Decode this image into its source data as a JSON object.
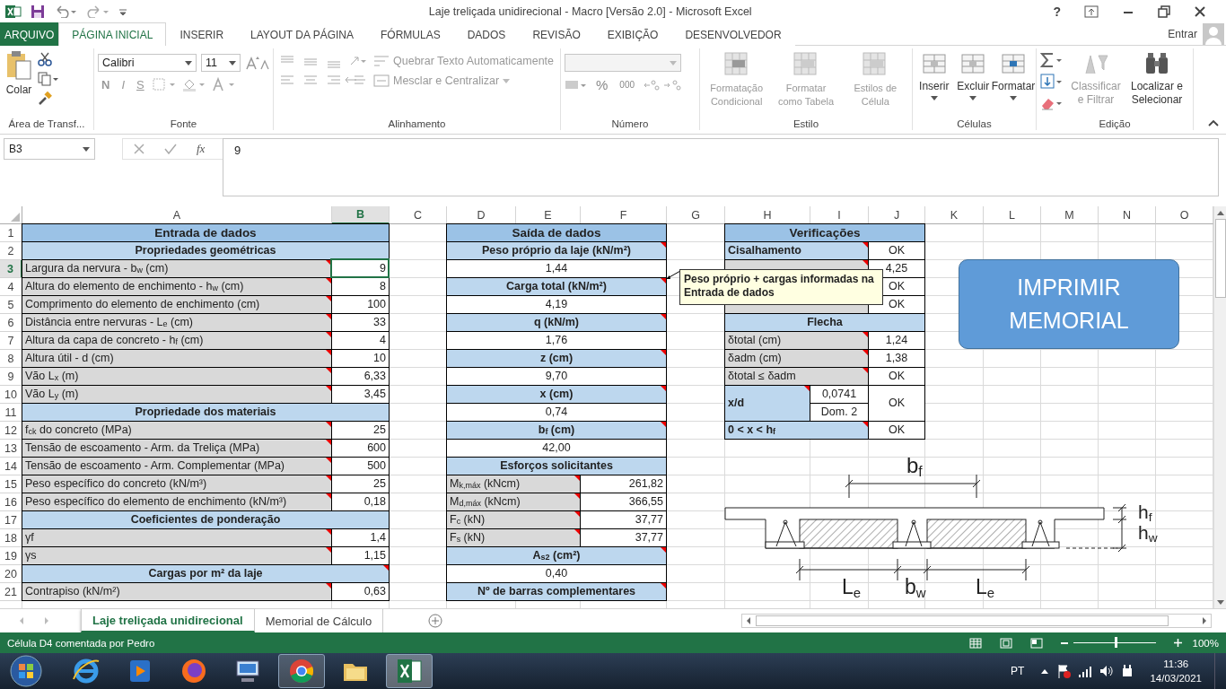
{
  "window": {
    "title": "Laje treliçada unidirecional - Macro [Versão 2.0] - Microsoft Excel",
    "help": "?",
    "account": "Entrar"
  },
  "tabs": [
    {
      "label": "ARQUIVO",
      "kind": "file",
      "selected": false
    },
    {
      "label": "PÁGINA INICIAL",
      "kind": "tab",
      "selected": true
    },
    {
      "label": "INSERIR",
      "kind": "tab",
      "selected": false
    },
    {
      "label": "LAYOUT DA PÁGINA",
      "kind": "tab",
      "selected": false
    },
    {
      "label": "FÓRMULAS",
      "kind": "tab",
      "selected": false
    },
    {
      "label": "DADOS",
      "kind": "tab",
      "selected": false
    },
    {
      "label": "REVISÃO",
      "kind": "tab",
      "selected": false
    },
    {
      "label": "EXIBIÇÃO",
      "kind": "tab",
      "selected": false
    },
    {
      "label": "DESENVOLVEDOR",
      "kind": "tab",
      "selected": false
    }
  ],
  "ribbon": {
    "clipboard": {
      "paste": "Colar",
      "label": "Área de Transf..."
    },
    "font": {
      "name": "Calibri",
      "size": "11",
      "bold": "N",
      "italic": "I",
      "underline": "S",
      "label": "Fonte"
    },
    "alignment": {
      "wrap": "Quebrar Texto Automaticamente",
      "merge": "Mesclar e Centralizar",
      "label": "Alinhamento"
    },
    "number": {
      "percent": "%",
      "thousands": "000",
      "label": "Número"
    },
    "styles": {
      "buttons": [
        {
          "label": "Formatação Condicional",
          "disabled": true
        },
        {
          "label": "Formatar como Tabela",
          "disabled": true
        },
        {
          "label": "Estilos de Célula",
          "disabled": true
        }
      ],
      "label": "Estilo"
    },
    "cells": {
      "buttons": [
        {
          "label": "Inserir",
          "disabled": false
        },
        {
          "label": "Excluir",
          "disabled": false
        },
        {
          "label": "Formatar",
          "disabled": false
        }
      ],
      "label": "Células"
    },
    "editing": {
      "buttons": [
        {
          "label": "Classificar e Filtrar",
          "disabled": true
        },
        {
          "label": "Localizar e Selecionar",
          "disabled": false
        }
      ],
      "label": "Edição"
    }
  },
  "formula_bar": {
    "name_box": "B3",
    "fx": "fx",
    "value": "9"
  },
  "grid": {
    "columns": [
      {
        "label": "A",
        "selected": false
      },
      {
        "label": "B",
        "selected": true
      },
      {
        "label": "C",
        "selected": false
      },
      {
        "label": "D",
        "selected": false
      },
      {
        "label": "E",
        "selected": false
      },
      {
        "label": "F",
        "selected": false
      },
      {
        "label": "G",
        "selected": false
      },
      {
        "label": "H",
        "selected": false
      },
      {
        "label": "I",
        "selected": false
      },
      {
        "label": "J",
        "selected": false
      },
      {
        "label": "K",
        "selected": false
      },
      {
        "label": "L",
        "selected": false
      },
      {
        "label": "M",
        "selected": false
      },
      {
        "label": "N",
        "selected": false
      },
      {
        "label": "O",
        "selected": false
      }
    ],
    "rows": [
      {
        "label": "1",
        "selected": false
      },
      {
        "label": "2",
        "selected": false
      },
      {
        "label": "3",
        "selected": true
      },
      {
        "label": "4",
        "selected": false
      },
      {
        "label": "5",
        "selected": false
      },
      {
        "label": "6",
        "selected": false
      },
      {
        "label": "7",
        "selected": false
      },
      {
        "label": "8",
        "selected": false
      },
      {
        "label": "9",
        "selected": false
      },
      {
        "label": "10",
        "selected": false
      },
      {
        "label": "11",
        "selected": false
      },
      {
        "label": "12",
        "selected": false
      },
      {
        "label": "13",
        "selected": false
      },
      {
        "label": "14",
        "selected": false
      },
      {
        "label": "15",
        "selected": false
      },
      {
        "label": "16",
        "selected": false
      },
      {
        "label": "17",
        "selected": false
      },
      {
        "label": "18",
        "selected": false
      },
      {
        "label": "19",
        "selected": false
      },
      {
        "label": "20",
        "selected": false
      },
      {
        "label": "21",
        "selected": false
      }
    ]
  },
  "input": {
    "items": [
      {
        "kind": "header",
        "text": "Entrada de dados"
      },
      {
        "kind": "subheader",
        "text": "Propriedades geométricas",
        "comment": false
      },
      {
        "kind": "field",
        "label": "Largura da nervura - b$_{w}$ (cm)",
        "value": "9",
        "comment": true
      },
      {
        "kind": "field",
        "label": "Altura do elemento de enchimento - h$_{w}$ (cm)",
        "value": "8",
        "comment": true
      },
      {
        "kind": "field",
        "label": "Comprimento do elemento de enchimento (cm)",
        "value": "100",
        "comment": true
      },
      {
        "kind": "field",
        "label": "Distância entre nervuras - L$_{e}$ (cm)",
        "value": "33",
        "comment": true
      },
      {
        "kind": "field",
        "label": "Altura da capa de concreto - h$_{f}$ (cm)",
        "value": "4",
        "comment": true
      },
      {
        "kind": "field",
        "label": "Altura útil - d (cm)",
        "value": "10",
        "comment": true
      },
      {
        "kind": "field",
        "label": "Vão L$_{x}$ (m)",
        "value": "6,33",
        "comment": true
      },
      {
        "kind": "field",
        "label": "Vão L$_{y}$ (m)",
        "value": "3,45",
        "comment": true
      },
      {
        "kind": "subheader",
        "text": "Propriedade dos materiais",
        "comment": false
      },
      {
        "kind": "field",
        "label": "f$_{ck}$ do concreto (MPa)",
        "value": "25",
        "comment": true
      },
      {
        "kind": "field",
        "label": "Tensão de escoamento - Arm. da Treliça (MPa)",
        "value": "600",
        "comment": true
      },
      {
        "kind": "field",
        "label": "Tensão de escoamento - Arm. Complementar (MPa)",
        "value": "500",
        "comment": true
      },
      {
        "kind": "field",
        "label": "Peso específico do concreto (kN/m³)",
        "value": "25",
        "comment": true
      },
      {
        "kind": "field",
        "label": "Peso específico do elemento de enchimento (kN/m³)",
        "value": "0,18",
        "comment": true
      },
      {
        "kind": "subheader",
        "text": "Coeficientes de ponderação",
        "comment": false
      },
      {
        "kind": "field",
        "label": "γf",
        "value": "1,4",
        "comment": true
      },
      {
        "kind": "field",
        "label": "γs",
        "value": "1,15",
        "comment": true
      },
      {
        "kind": "subheader",
        "text": "Cargas por m² da laje",
        "comment": true
      },
      {
        "kind": "field",
        "label": "Contrapiso (kN/m²)",
        "value": "0,63",
        "comment": true
      }
    ]
  },
  "output": {
    "items": [
      {
        "kind": "header",
        "text": "Saída de dados"
      },
      {
        "kind": "subheader",
        "text": "Peso próprio da laje (kN/m²)",
        "comment": true
      },
      {
        "kind": "value",
        "text": "1,44"
      },
      {
        "kind": "subheader",
        "text": "Carga total (kN/m²)",
        "comment": true
      },
      {
        "kind": "value",
        "text": "4,19"
      },
      {
        "kind": "subheader",
        "text": "q (kN/m)",
        "comment": true
      },
      {
        "kind": "value",
        "text": "1,76"
      },
      {
        "kind": "subheader",
        "text": "z (cm)",
        "comment": true
      },
      {
        "kind": "value",
        "text": "9,70"
      },
      {
        "kind": "subheader",
        "text": "x (cm)",
        "comment": true
      },
      {
        "kind": "value",
        "text": "0,74"
      },
      {
        "kind": "subheader",
        "text": "b$_{f}$ (cm)",
        "comment": true
      },
      {
        "kind": "value",
        "text": "42,00"
      },
      {
        "kind": "subheader",
        "text": "Esforços solicitantes",
        "comment": false
      },
      {
        "kind": "field",
        "label": "M$_{k,máx}$ (kNcm)",
        "value": "261,82",
        "comment": true
      },
      {
        "kind": "field",
        "label": "M$_{d,máx}$ (kNcm)",
        "value": "366,55",
        "comment": true
      },
      {
        "kind": "field",
        "label": "F$_{c}$ (kN)",
        "value": "37,77",
        "comment": true
      },
      {
        "kind": "field",
        "label": "F$_{s}$ (kN)",
        "value": "37,77",
        "comment": true
      },
      {
        "kind": "subheader",
        "text": "A$_{s2}$ (cm²)",
        "comment": true
      },
      {
        "kind": "value",
        "text": "0,40"
      },
      {
        "kind": "subheader",
        "text": "Nº de barras complementares",
        "comment": true
      }
    ]
  },
  "checks": {
    "items": [
      {
        "kind": "header",
        "text": "Verificações"
      },
      {
        "kind": "check",
        "label": "Cisalhamento",
        "value": "OK",
        "comment": true
      },
      {
        "kind": "field",
        "value": "4,25",
        "comment": true
      },
      {
        "kind": "result",
        "value": "OK"
      },
      {
        "kind": "field",
        "value": "OK"
      },
      {
        "kind": "subheader",
        "text": "Flecha",
        "comment": false
      },
      {
        "kind": "field",
        "label": "δtotal (cm)",
        "value": "1,24",
        "comment": true
      },
      {
        "kind": "field",
        "label": "δadm (cm)",
        "value": "1,38",
        "comment": true
      },
      {
        "kind": "field",
        "label": "δtotal ≤ δadm",
        "value": "OK",
        "comment": true
      },
      {
        "kind": "ratio",
        "label": "x/d",
        "values": [
          "0,0741",
          "Dom. 2"
        ],
        "value": "OK",
        "comment": true
      },
      {
        "kind": "check",
        "label": "0 < x < h$_{f}$",
        "value": "OK",
        "comment": true
      }
    ]
  },
  "comment": {
    "text": "Peso próprio + cargas informadas na Entrada de dados"
  },
  "print_button": "IMPRIMIR MEMORIAL",
  "diagram": {
    "labels": [
      "b$_{f}$",
      "h$_{f}$",
      "h$_{w}$",
      "L$_{e}$",
      "b$_{w}$",
      "L$_{e}$"
    ]
  },
  "sheets": [
    {
      "label": "Laje treliçada unidirecional",
      "selected": true
    },
    {
      "label": "Memorial de Cálculo",
      "selected": false
    }
  ],
  "status_bar": {
    "text": "Célula D4 comentada por Pedro",
    "zoom": {
      "label": "100%",
      "level": 0.5
    }
  },
  "taskbar": {
    "apps": [
      {
        "kind": "ie",
        "open": false
      },
      {
        "kind": "media",
        "open": false
      },
      {
        "kind": "firefox",
        "open": false
      },
      {
        "kind": "computer",
        "open": false
      },
      {
        "kind": "chrome",
        "open": true
      },
      {
        "kind": "folder",
        "open": false
      },
      {
        "kind": "excel",
        "open": true
      }
    ],
    "language": "PT",
    "time": "11:36",
    "date": "14/03/2021"
  }
}
